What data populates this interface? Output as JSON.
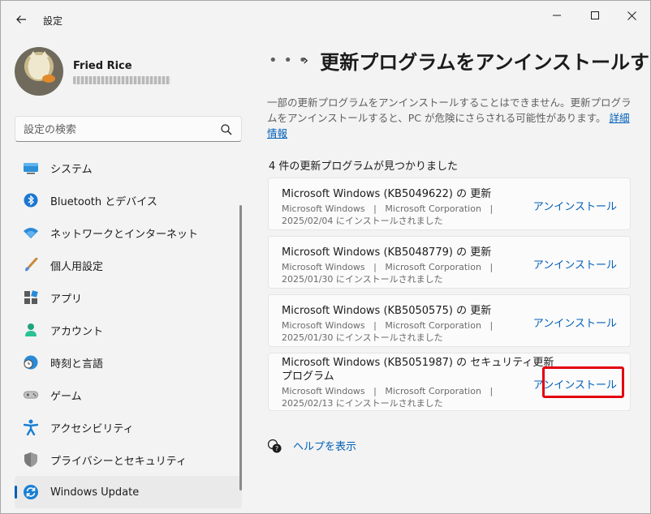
{
  "window": {
    "app_title": "設定",
    "controls": {
      "minimize": "minimize-icon",
      "maximize": "maximize-icon",
      "close": "close-icon"
    }
  },
  "profile": {
    "name": "Fried Rice",
    "email_redacted": true
  },
  "search": {
    "placeholder": "設定の検索",
    "value": ""
  },
  "sidebar": {
    "items": [
      {
        "label": "システム",
        "icon": "system-icon",
        "active": false
      },
      {
        "label": "Bluetooth とデバイス",
        "icon": "bluetooth-icon",
        "active": false
      },
      {
        "label": "ネットワークとインターネット",
        "icon": "wifi-icon",
        "active": false
      },
      {
        "label": "個人用設定",
        "icon": "paintbrush-icon",
        "active": false
      },
      {
        "label": "アプリ",
        "icon": "apps-icon",
        "active": false
      },
      {
        "label": "アカウント",
        "icon": "account-icon",
        "active": false
      },
      {
        "label": "時刻と言語",
        "icon": "clock-globe-icon",
        "active": false
      },
      {
        "label": "ゲーム",
        "icon": "gamepad-icon",
        "active": false
      },
      {
        "label": "アクセシビリティ",
        "icon": "accessibility-icon",
        "active": false
      },
      {
        "label": "プライバシーとセキュリティ",
        "icon": "shield-icon",
        "active": false
      },
      {
        "label": "Windows Update",
        "icon": "windows-update-icon",
        "active": true
      }
    ]
  },
  "main": {
    "breadcrumb": {
      "more": "…",
      "separator": "›",
      "title": "更新プログラムをアンインストールす"
    },
    "description": "一部の更新プログラムをアンインストールすることはできません。更新プログラムをアンインストールすると、PC が危険にさらされる可能性があります。",
    "details_link": "詳細情報",
    "found_count": "4 件の更新プログラムが見つかりました",
    "updates": [
      {
        "title": "Microsoft Windows (KB5049622) の 更新",
        "product": "Microsoft Windows",
        "publisher": "Microsoft Corporation",
        "installed": "2025/02/04 にインストールされました",
        "action": "アンインストール",
        "highlighted": false
      },
      {
        "title": "Microsoft Windows (KB5048779) の 更新",
        "product": "Microsoft Windows",
        "publisher": "Microsoft Corporation",
        "installed": "2025/01/30 にインストールされました",
        "action": "アンインストール",
        "highlighted": false
      },
      {
        "title": "Microsoft Windows (KB5050575) の 更新",
        "product": "Microsoft Windows",
        "publisher": "Microsoft Corporation",
        "installed": "2025/01/30 にインストールされました",
        "action": "アンインストール",
        "highlighted": false
      },
      {
        "title_line1": "Microsoft Windows (KB5051987) の セキュリティ更新",
        "title_line2": "プログラム",
        "product": "Microsoft Windows",
        "publisher": "Microsoft Corporation",
        "installed": "2025/02/13 にインストールされました",
        "action": "アンインストール",
        "highlighted": true
      }
    ],
    "meta_separator": "|",
    "help_link": "ヘルプを表示"
  },
  "colors": {
    "accent": "#005fb8",
    "highlight_box": "#e3000f",
    "background": "#f3f3f3",
    "card": "#fbfbfb"
  }
}
